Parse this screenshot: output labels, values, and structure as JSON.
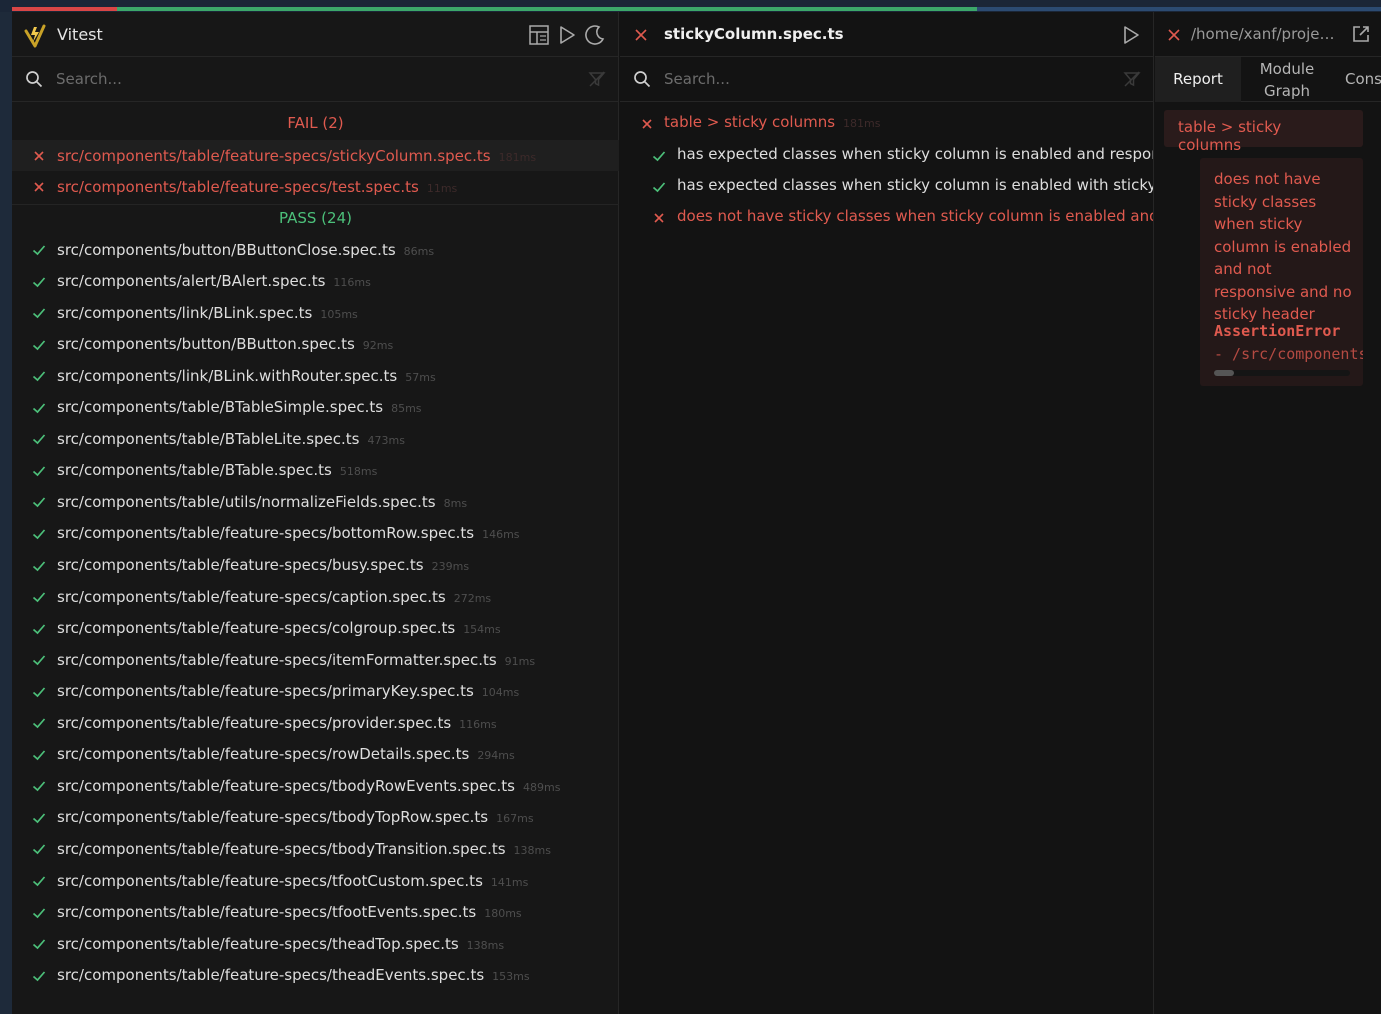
{
  "progress": {
    "failed_count": 2,
    "passed_count": 24
  },
  "app": {
    "title": "Vitest"
  },
  "search": {
    "placeholder": "Search..."
  },
  "explorer": {
    "fail_group": "FAIL (2)",
    "pass_group": "PASS (24)",
    "failed_files": [
      {
        "name": "src/components/table/feature-specs/stickyColumn.spec.ts",
        "duration": "181ms"
      },
      {
        "name": "src/components/table/feature-specs/test.spec.ts",
        "duration": "11ms"
      }
    ],
    "passed_files": [
      {
        "name": "src/components/button/BButtonClose.spec.ts",
        "duration": "86ms"
      },
      {
        "name": "src/components/alert/BAlert.spec.ts",
        "duration": "116ms"
      },
      {
        "name": "src/components/link/BLink.spec.ts",
        "duration": "105ms"
      },
      {
        "name": "src/components/button/BButton.spec.ts",
        "duration": "92ms"
      },
      {
        "name": "src/components/link/BLink.withRouter.spec.ts",
        "duration": "57ms"
      },
      {
        "name": "src/components/table/BTableSimple.spec.ts",
        "duration": "85ms"
      },
      {
        "name": "src/components/table/BTableLite.spec.ts",
        "duration": "473ms"
      },
      {
        "name": "src/components/table/BTable.spec.ts",
        "duration": "518ms"
      },
      {
        "name": "src/components/table/utils/normalizeFields.spec.ts",
        "duration": "8ms"
      },
      {
        "name": "src/components/table/feature-specs/bottomRow.spec.ts",
        "duration": "146ms"
      },
      {
        "name": "src/components/table/feature-specs/busy.spec.ts",
        "duration": "239ms"
      },
      {
        "name": "src/components/table/feature-specs/caption.spec.ts",
        "duration": "272ms"
      },
      {
        "name": "src/components/table/feature-specs/colgroup.spec.ts",
        "duration": "154ms"
      },
      {
        "name": "src/components/table/feature-specs/itemFormatter.spec.ts",
        "duration": "91ms"
      },
      {
        "name": "src/components/table/feature-specs/primaryKey.spec.ts",
        "duration": "104ms"
      },
      {
        "name": "src/components/table/feature-specs/provider.spec.ts",
        "duration": "116ms"
      },
      {
        "name": "src/components/table/feature-specs/rowDetails.spec.ts",
        "duration": "294ms"
      },
      {
        "name": "src/components/table/feature-specs/tbodyRowEvents.spec.ts",
        "duration": "489ms"
      },
      {
        "name": "src/components/table/feature-specs/tbodyTopRow.spec.ts",
        "duration": "167ms"
      },
      {
        "name": "src/components/table/feature-specs/tbodyTransition.spec.ts",
        "duration": "138ms"
      },
      {
        "name": "src/components/table/feature-specs/tfootCustom.spec.ts",
        "duration": "141ms"
      },
      {
        "name": "src/components/table/feature-specs/tfootEvents.spec.ts",
        "duration": "180ms"
      },
      {
        "name": "src/components/table/feature-specs/theadTop.spec.ts",
        "duration": "138ms"
      },
      {
        "name": "src/components/table/feature-specs/theadEvents.spec.ts",
        "duration": "153ms"
      }
    ]
  },
  "detail": {
    "file_title": "stickyColumn.spec.ts",
    "suite": {
      "name": "table > sticky columns",
      "duration": "181ms"
    },
    "tests": [
      {
        "name": "has expected classes when sticky column is enabled and responsive",
        "status": "pass"
      },
      {
        "name": "has expected classes when sticky column is enabled with sticky header",
        "status": "pass"
      },
      {
        "name": "does not have sticky classes when sticky column is enabled and not responsive",
        "status": "fail"
      }
    ]
  },
  "report": {
    "path": "/home/xanf/projects/bootstrap-vue",
    "tabs": [
      "Report",
      "Module Graph",
      "Console"
    ],
    "active_tab": "Report",
    "suite_header": "table > sticky columns",
    "error_message": "does not have sticky classes when sticky column is enabled and not responsive and no sticky header",
    "error_type": "AssertionError",
    "error_stack": " - /src/components/table/feature-specs/stickyColumn.spec.ts"
  },
  "colors": {
    "fail": "#e05a4f",
    "pass": "#4cc07a",
    "background": "#131313"
  },
  "icons": [
    "vitest-logo-icon",
    "dashboard-icon",
    "play-icon",
    "moon-icon",
    "search-icon",
    "filter-icon",
    "close-icon",
    "check-icon",
    "external-link-icon"
  ]
}
